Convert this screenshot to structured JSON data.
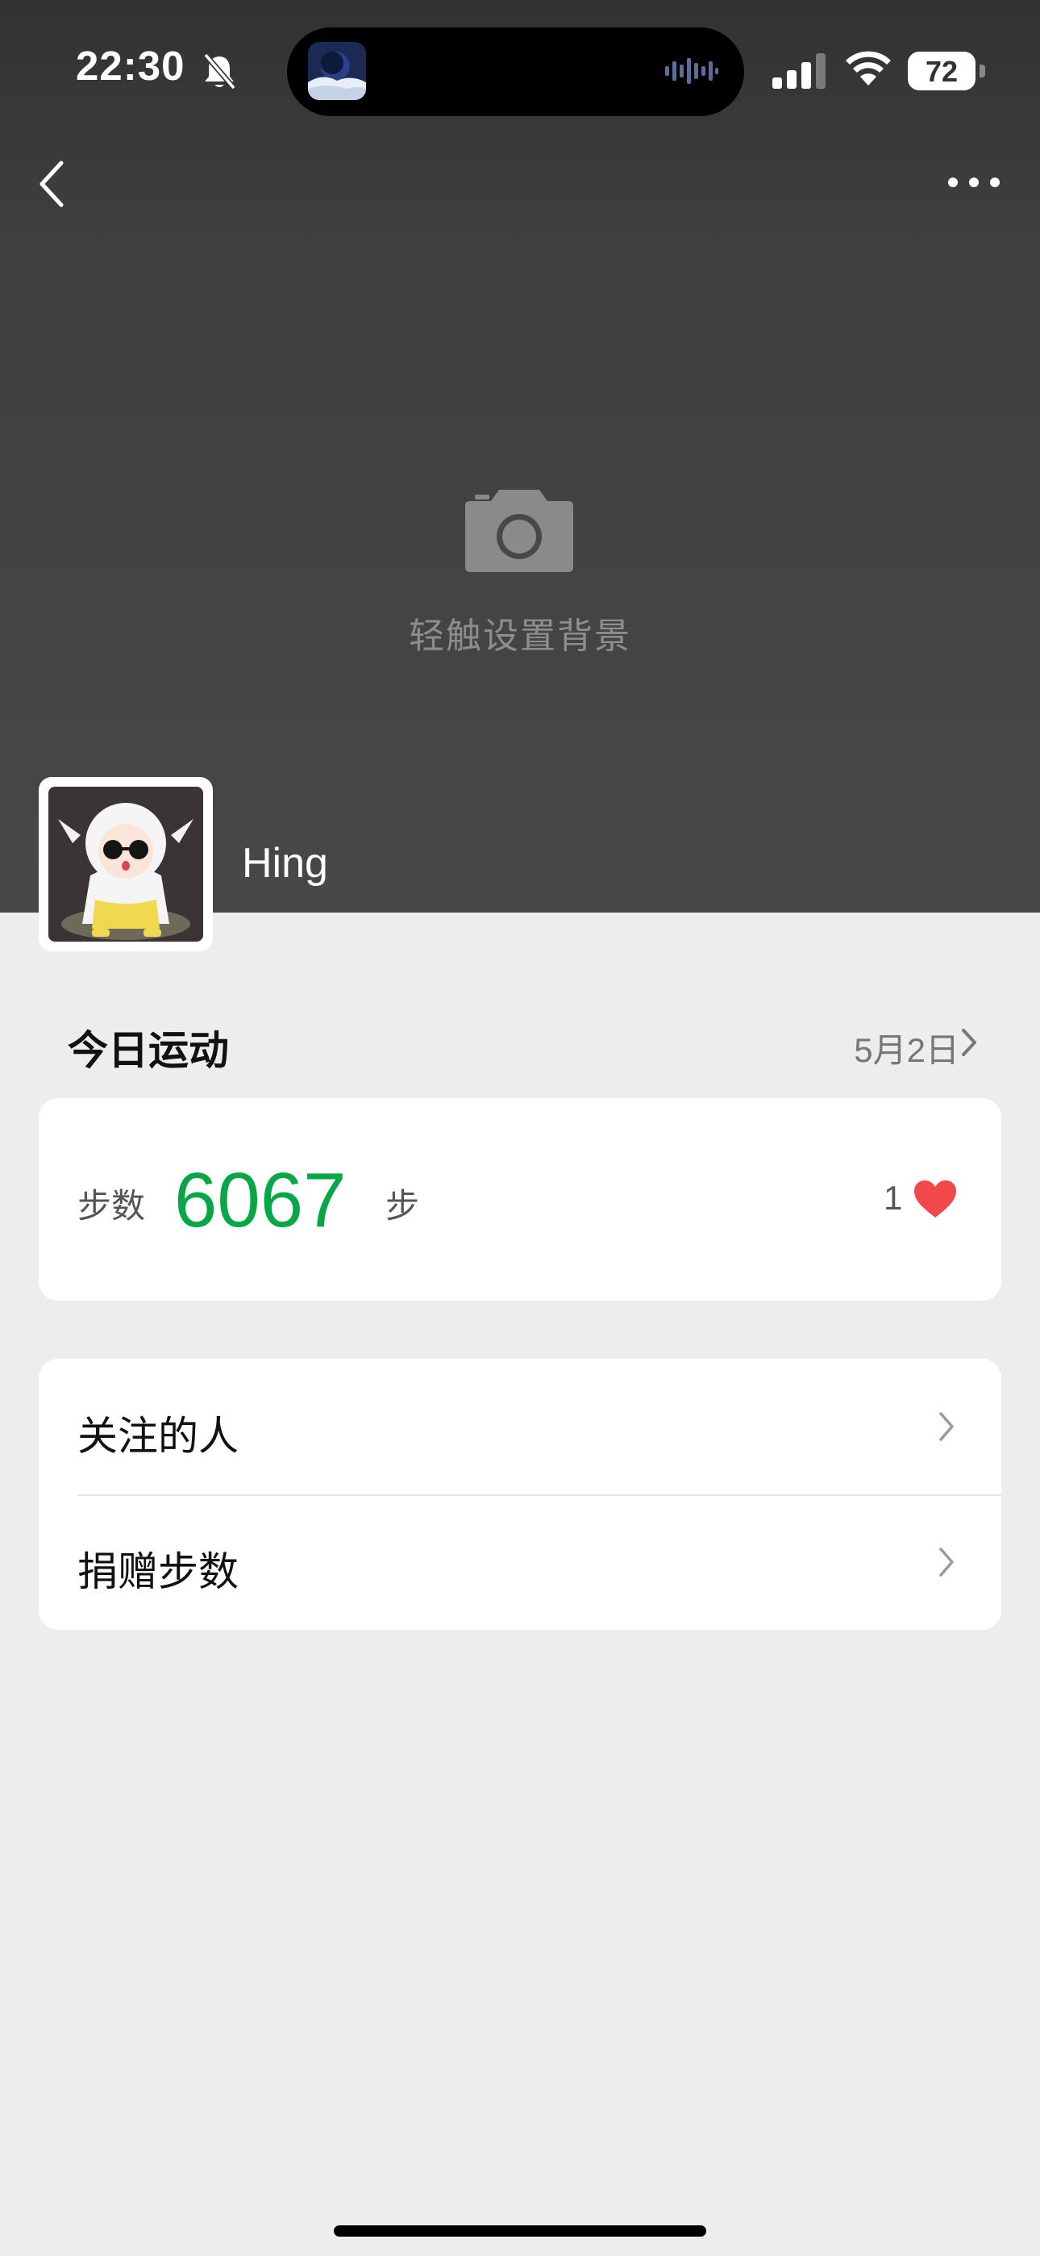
{
  "status_bar": {
    "time": "22:30",
    "battery_percent": "72"
  },
  "header": {
    "background_hint": "轻触设置背景"
  },
  "profile": {
    "username": "Hing"
  },
  "today": {
    "title": "今日运动",
    "date": "5月2日",
    "steps_label": "步数",
    "steps_value": "6067",
    "steps_unit": "步",
    "likes_count": "1"
  },
  "menu": {
    "items": [
      {
        "label": "关注的人"
      },
      {
        "label": "捐赠步数"
      }
    ]
  },
  "colors": {
    "accent_green": "#07a646",
    "heart_red": "#f2484a",
    "header_bg": "#484848",
    "page_bg": "#ededed"
  }
}
